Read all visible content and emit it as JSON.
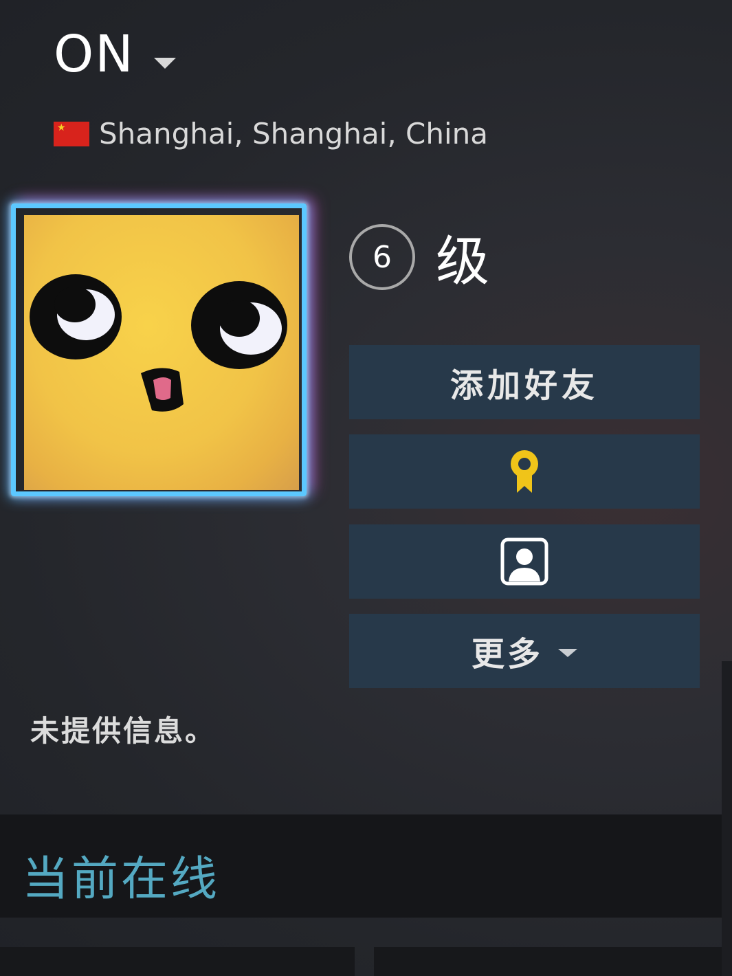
{
  "profile": {
    "persona_name": "ON",
    "location": "Shanghai, Shanghai, China",
    "level": "6",
    "level_label": "级",
    "summary": "未提供信息。"
  },
  "buttons": {
    "add_friend": "添加好友",
    "more": "更多"
  },
  "icons": {
    "name_dropdown": "chevron-down-icon",
    "flag": "china-flag-icon",
    "award": "award-ribbon-icon",
    "avatar_button": "user-avatar-icon"
  },
  "status": {
    "label": "当前在线"
  },
  "colors": {
    "status_text": "#54a9c2",
    "button_bg": "#27394a",
    "avatar_frame": "#5cc8ff",
    "award": "#f0c419"
  }
}
